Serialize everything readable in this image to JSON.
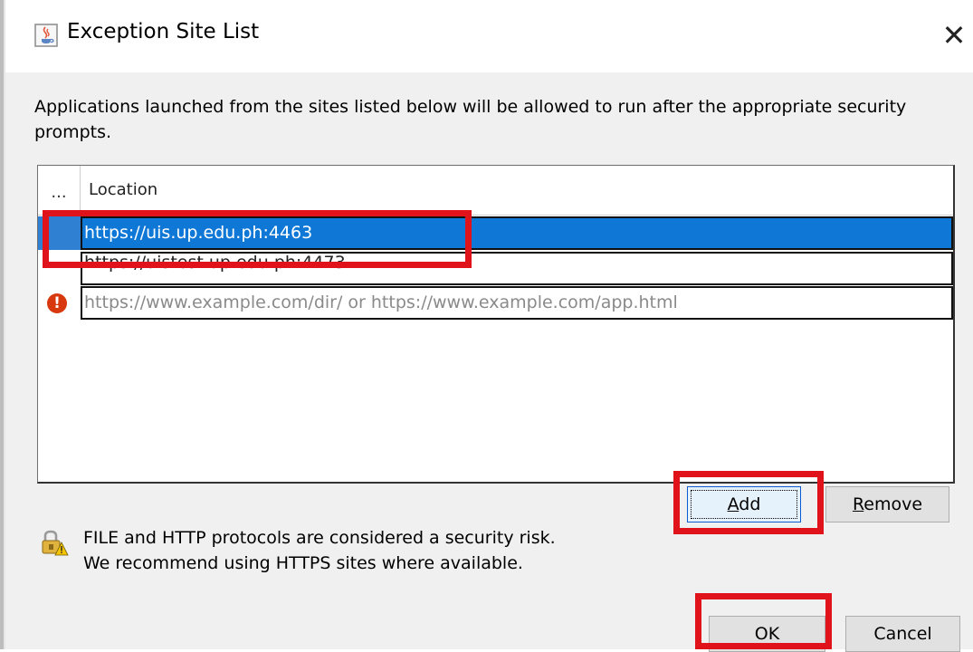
{
  "window": {
    "title": "Exception Site List",
    "app_icon": "java-cup-icon",
    "close_glyph": "✕"
  },
  "description": "Applications launched from the sites listed below will be allowed to run after the appropriate security prompts.",
  "table": {
    "header_first": "...",
    "header_location": "Location",
    "rows": [
      {
        "location": "https://uis.up.edu.ph:4463",
        "selected": true
      },
      {
        "location": "https://uistest.up.edu.ph:4473",
        "selected": false
      },
      {
        "location": "https://www.example.com/dir/ or https://www.example.com/app.html",
        "placeholder": true,
        "status_icon": "error-icon",
        "status_glyph": "!"
      }
    ]
  },
  "buttons": {
    "add": {
      "label_mnemonic": "A",
      "label_rest": "dd"
    },
    "remove": {
      "label_mnemonic": "R",
      "label_rest": "emove"
    },
    "ok": "OK",
    "cancel": "Cancel"
  },
  "security_note": {
    "icon": "lock-warning-icon",
    "line1": "FILE and HTTP protocols are considered a security risk.",
    "line2": "We recommend using HTTPS sites where available."
  },
  "colors": {
    "selection": "#0f78d7",
    "annotation": "#e0131a",
    "error": "#d8380d"
  }
}
